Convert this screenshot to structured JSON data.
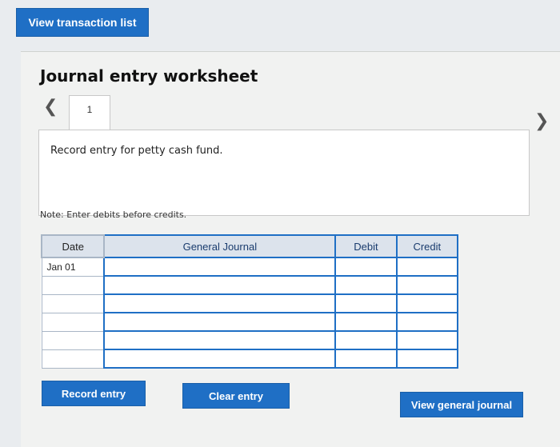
{
  "header": {
    "view_transaction_list_label": "View transaction list"
  },
  "worksheet": {
    "title": "Journal entry worksheet",
    "active_tab": "1",
    "prompt": "Record entry for petty cash fund.",
    "note": "Note: Enter debits before credits."
  },
  "table": {
    "headers": {
      "date": "Date",
      "general_journal": "General Journal",
      "debit": "Debit",
      "credit": "Credit"
    },
    "rows": [
      {
        "date": "Jan 01",
        "account": "",
        "debit": "",
        "credit": ""
      },
      {
        "date": "",
        "account": "",
        "debit": "",
        "credit": ""
      },
      {
        "date": "",
        "account": "",
        "debit": "",
        "credit": ""
      },
      {
        "date": "",
        "account": "",
        "debit": "",
        "credit": ""
      },
      {
        "date": "",
        "account": "",
        "debit": "",
        "credit": ""
      },
      {
        "date": "",
        "account": "",
        "debit": "",
        "credit": ""
      }
    ]
  },
  "buttons": {
    "record_entry": "Record entry",
    "clear_entry": "Clear entry",
    "view_general_journal": "View general journal"
  },
  "icons": {
    "prev": "chevron-left-icon",
    "next": "chevron-right-icon"
  },
  "colors": {
    "accent": "#1f6fc5",
    "header_bg": "#dce3ec"
  }
}
